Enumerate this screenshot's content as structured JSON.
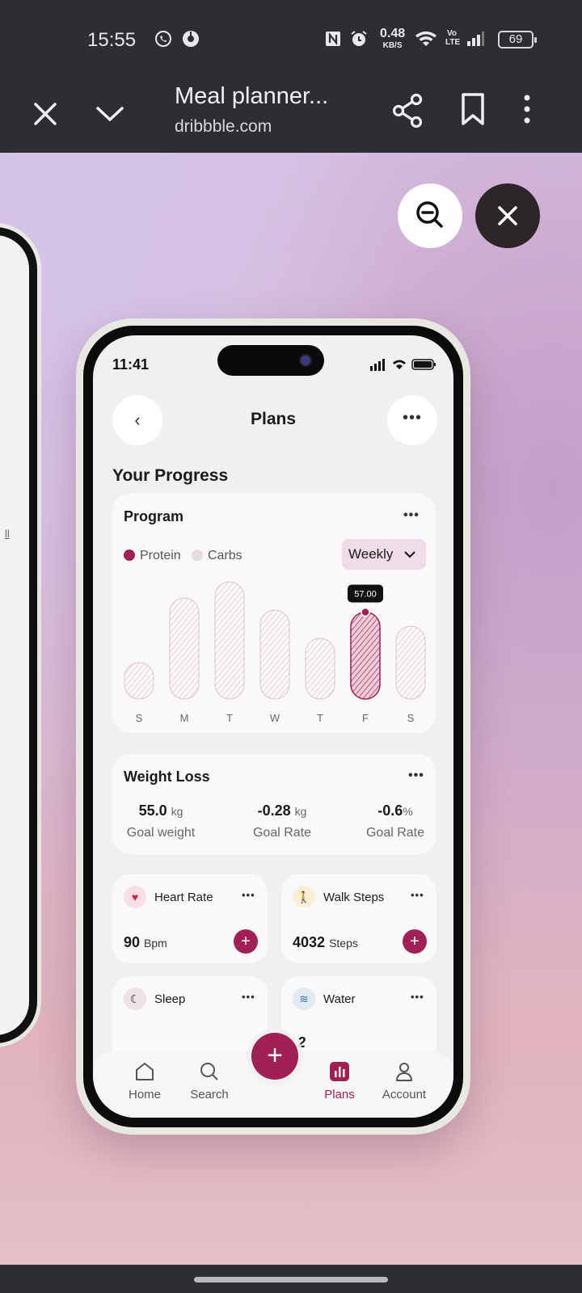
{
  "android_status": {
    "time": "15:55",
    "net_speed_value": "0.48",
    "net_speed_unit": "KB/S",
    "volte": "Vo LTE",
    "battery": "69"
  },
  "browser": {
    "title": "Meal planner...",
    "domain": "dribbble.com"
  },
  "ghost_phone": {
    "link_fragment": "ll"
  },
  "phone_status": {
    "time": "11:41"
  },
  "nav": {
    "title": "Plans"
  },
  "progress": {
    "section_title": "Your Progress"
  },
  "program": {
    "title": "Program",
    "legend": [
      {
        "label": "Protein",
        "color": "#a01f55"
      },
      {
        "label": "Carbs",
        "color": "#e2dde0"
      }
    ],
    "period": "Weekly",
    "tooltip": "57.00"
  },
  "chart_data": {
    "type": "bar",
    "categories": [
      "S",
      "M",
      "T",
      "W",
      "T",
      "F",
      "S"
    ],
    "series": [
      {
        "values": [
          18,
          50,
          58,
          44,
          30,
          43,
          36
        ]
      }
    ],
    "highlight_index": 5,
    "highlight_label": "57.00",
    "ylim": [
      0,
      60
    ],
    "grid": false
  },
  "weight_loss": {
    "title": "Weight Loss",
    "stats": [
      {
        "value": "55.0",
        "unit": "kg",
        "label": "Goal weight"
      },
      {
        "value": "-0.28",
        "unit": "kg",
        "label": "Goal Rate"
      },
      {
        "value": "-0.6",
        "unit": "%",
        "label": "Goal Rate"
      }
    ]
  },
  "cards": {
    "heart": {
      "title": "Heart Rate",
      "value": "90",
      "unit": "Bpm"
    },
    "walk": {
      "title": "Walk Steps",
      "value": "4032",
      "unit": "Steps"
    },
    "sleep": {
      "title": "Sleep"
    },
    "water": {
      "title": "Water",
      "value_fragment": "2"
    }
  },
  "tabs": [
    {
      "label": "Home",
      "icon": "home-icon"
    },
    {
      "label": "Search",
      "icon": "search-icon"
    },
    {
      "label": "Plans",
      "icon": "chart-icon"
    },
    {
      "label": "Account",
      "icon": "user-icon"
    }
  ],
  "colors": {
    "accent": "#a01f55",
    "accent_light": "#eedce6",
    "background": "#f2eff3"
  }
}
